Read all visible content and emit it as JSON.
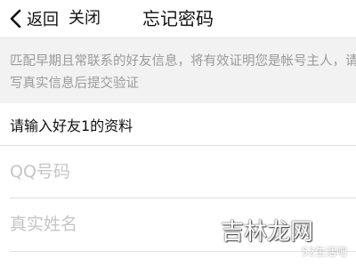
{
  "navbar": {
    "back_label": "返回",
    "close_label": "关闭",
    "title": "忘记密码"
  },
  "notice": {
    "text": "匹配早期且常联系的好友信息，将有效证明您是帐号主人，请填写真实信息后提交验证"
  },
  "form": {
    "section_title": "请输入好友1的资料",
    "qq_placeholder": "QQ号码",
    "qq_value": "",
    "name_placeholder": "真实姓名",
    "name_value": ""
  },
  "watermark": {
    "big": "吉林龙网",
    "small": "52生活吧"
  },
  "icons": {
    "back": "chevron-left-icon"
  },
  "colors": {
    "background": "#ffffff",
    "notice_bg": "#f2f2f2",
    "notice_text": "#9a9a9a",
    "placeholder": "#c5c5c5",
    "divider": "#e0e0e0"
  }
}
